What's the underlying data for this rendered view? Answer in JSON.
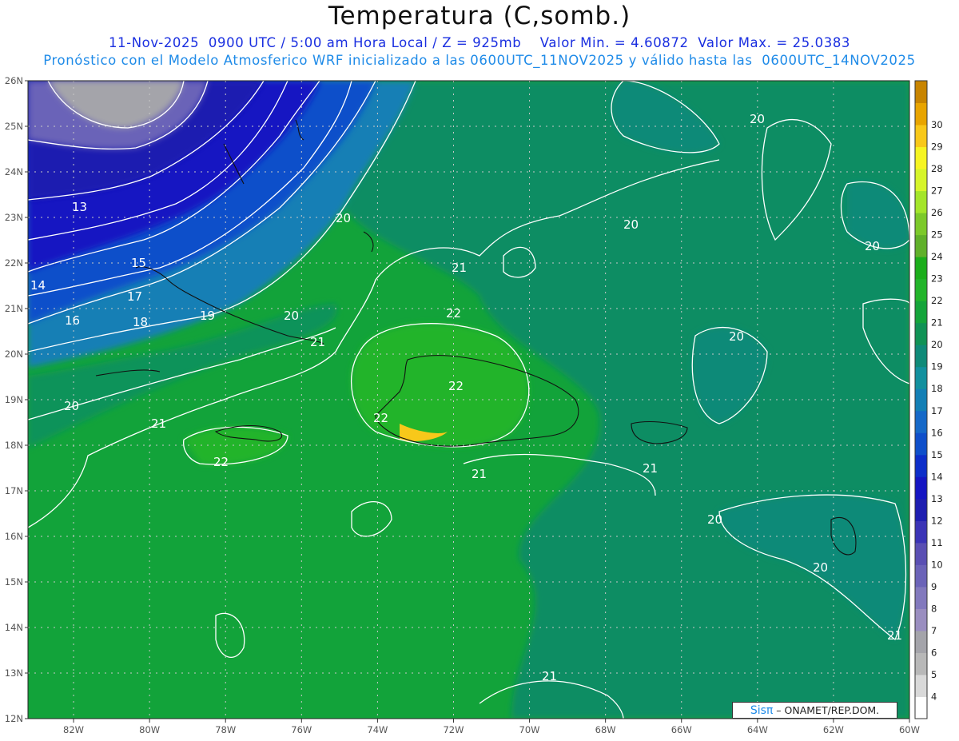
{
  "title": "Temperatura (C,somb.)",
  "subtitle_line1": "11-Nov-2025  0900 UTC / 5:00 am Hora Local / Z = 925mb    Valor Min. = 4.60872  Valor Max. = 25.0383",
  "subtitle_line2": "Pronóstico con el Modelo Atmosferico WRF inicializado a las 0600UTC_11NOV2025 y válido hasta las  0600UTC_14NOV2025",
  "map": {
    "lon_range": [
      -83.2,
      -60
    ],
    "lat_range": [
      12,
      26
    ],
    "lon_tick_labels": [
      "82W",
      "80W",
      "78W",
      "76W",
      "74W",
      "72W",
      "70W",
      "68W",
      "66W",
      "64W",
      "62W",
      "60W"
    ],
    "lon_tick_values": [
      -82,
      -80,
      -78,
      -76,
      -74,
      -72,
      -70,
      -68,
      -66,
      -64,
      -62,
      -60
    ],
    "lat_tick_labels": [
      "12N",
      "13N",
      "14N",
      "15N",
      "16N",
      "17N",
      "18N",
      "19N",
      "20N",
      "21N",
      "22N",
      "23N",
      "24N",
      "25N",
      "26N"
    ],
    "lat_tick_values": [
      12,
      13,
      14,
      15,
      16,
      17,
      18,
      19,
      20,
      21,
      22,
      23,
      24,
      25,
      26
    ],
    "gridlines": true
  },
  "colorbar": {
    "levels": [
      "4",
      "5",
      "6",
      "7",
      "8",
      "9",
      "10",
      "11",
      "12",
      "13",
      "14",
      "15",
      "16",
      "17",
      "18",
      "19",
      "20",
      "21",
      "22",
      "23",
      "24",
      "25",
      "26",
      "27",
      "28",
      "29",
      "30"
    ],
    "colors": [
      "#ffffff",
      "#d9d9d9",
      "#b8b8b8",
      "#a4a4aa",
      "#9a8ec0",
      "#8279bd",
      "#6b63b8",
      "#5a4fb3",
      "#3b34b6",
      "#1e1eb0",
      "#1515c2",
      "#0d2ec9",
      "#0f4fca",
      "#1669c8",
      "#137fb5",
      "#12909e",
      "#0f8a78",
      "#109255",
      "#14a43a",
      "#22b42a",
      "#1bad1b",
      "#60b02a",
      "#7cc92a",
      "#a4e52a",
      "#d6f42a",
      "#f6f422",
      "#f8c81a",
      "#e8a400",
      "#c88400"
    ]
  },
  "contour_labels": [
    "13",
    "14",
    "15",
    "16",
    "17",
    "18",
    "19",
    "20",
    "20",
    "20",
    "20",
    "20",
    "20",
    "20",
    "20",
    "20",
    "21",
    "21",
    "21",
    "21",
    "21",
    "21",
    "21",
    "22",
    "22",
    "22",
    "22"
  ],
  "credit": {
    "brand": "Sisπ",
    "text": "– ONAMET/REP.DOM."
  }
}
